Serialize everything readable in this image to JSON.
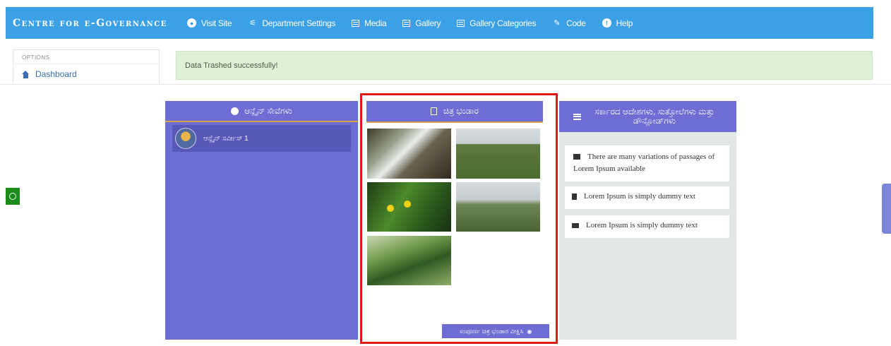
{
  "navbar": {
    "brand": "Centre for e-Governance",
    "items": [
      {
        "label": "Visit Site",
        "icon": "globe-icon"
      },
      {
        "label": "Department Settings",
        "icon": "sliders-icon"
      },
      {
        "label": "Media",
        "icon": "media-icon"
      },
      {
        "label": "Gallery",
        "icon": "gallery-icon"
      },
      {
        "label": "Gallery Categories",
        "icon": "gallery-categories-icon"
      },
      {
        "label": "Code",
        "icon": "pencil-icon"
      },
      {
        "label": "Help",
        "icon": "info-icon"
      }
    ]
  },
  "sidebar": {
    "heading": "OPTIONS",
    "dashboard_label": "Dashboard"
  },
  "alert": {
    "message": "Data Trashed successfully!"
  },
  "online_services": {
    "title": "ಆನ್ಲೈನ್ ಸೇವೆಗಳು",
    "items": [
      {
        "label": "ಆನ್ಲೈನ್ ಸರ್ವೀಸ್ 1"
      }
    ]
  },
  "photo_gallery": {
    "title": "ಚಿತ್ರ ಭಂಡಾರ",
    "view_all_label": "ಸಂಪೂರ್ಣ ಚಿತ್ರ ಭಂಡಾರ ವೀಕ್ಷಿಸಿ"
  },
  "documents": {
    "title": "ಸರ್ಕಾರದ ಆದೇಶಗಳು, ಸುತ್ತೋಲೆಗಳು ಮತ್ತು ಡೌನ್ಲೋಡ್‌ಗಳು",
    "items": [
      {
        "label": "There are many variations of passages of Lorem Ipsum available",
        "icon": "briefcase-icon"
      },
      {
        "label": "Lorem Ipsum is simply dummy text",
        "icon": "book-icon"
      },
      {
        "label": "Lorem Ipsum is simply dummy text",
        "icon": "list-icon"
      }
    ]
  },
  "colors": {
    "navbar": "#3ca0e6",
    "panel": "#6d6dd3",
    "alert_bg": "#dff0d8",
    "highlight": "#e01818"
  }
}
